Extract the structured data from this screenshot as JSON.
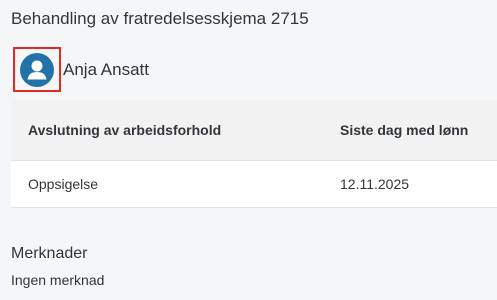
{
  "page": {
    "title": "Behandling av fratredelsesskjema 2715"
  },
  "employee": {
    "name": "Anja Ansatt",
    "avatar_icon": "person-icon",
    "avatar_color": "#2372a8",
    "highlight_color": "#e52920"
  },
  "table": {
    "headers": [
      "Avslutning av arbeidsforhold",
      "Siste dag med lønn"
    ],
    "rows": [
      [
        "Oppsigelse",
        "12.11.2025"
      ]
    ]
  },
  "remarks": {
    "heading": "Merknader",
    "text": "Ingen merknad"
  }
}
